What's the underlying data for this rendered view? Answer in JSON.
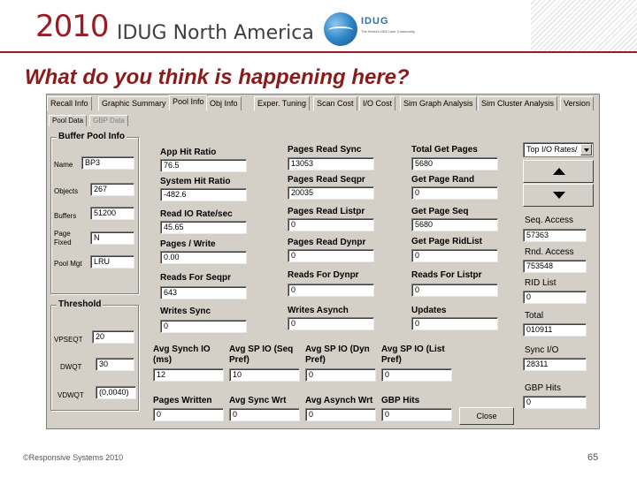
{
  "header": {
    "year": "2010",
    "conference": "IDUG North America",
    "logo_text": "IDUG",
    "logo_tagline": "The World's DB2 User Community"
  },
  "slide": {
    "title": "What do you think is happening here?",
    "copyright": "©Responsive Systems 2010",
    "page_number": "65"
  },
  "tabs": [
    "Recall Info",
    "Graphic Summary",
    "Pool Info",
    "Obj Info",
    "Exper. Tuning",
    "Scan Cost",
    "I/O Cost",
    "Sim Graph Analysis",
    "Sim Cluster Analysis",
    "Version"
  ],
  "active_tab": "Pool Info",
  "subtabs": [
    "Pool Data",
    "GBP Data"
  ],
  "buffer_pool": {
    "title": "Buffer Pool Info",
    "name_label": "Name",
    "name_value": "BP3",
    "objects_label": "Objects",
    "objects_value": "267",
    "buffers_label": "Buffers",
    "buffers_value": "51200",
    "pagefixed_label": "Page Fixed",
    "pagefixed_value": "N",
    "poolmgt_label": "Pool Mgt",
    "poolmgt_value": "LRU"
  },
  "threshold": {
    "title": "Threshold",
    "vpseqt_label": "VPSEQT",
    "vpseqt_value": "20",
    "dwqt_label": "DWQT",
    "dwqt_value": "30",
    "vdwqt_label": "VDWQT",
    "vdwqt_value": "(0,0040)"
  },
  "metrics": {
    "app_hit_ratio": {
      "label": "App Hit Ratio",
      "value": "76.5"
    },
    "system_hit_ratio": {
      "label": "System Hit Ratio",
      "value": "-482.6"
    },
    "read_io_rate": {
      "label": "Read IO Rate/sec",
      "value": "45.65"
    },
    "pages_write": {
      "label": "Pages / Write",
      "value": "0.00"
    },
    "reads_for_seqpr": {
      "label": "Reads For Seqpr",
      "value": "643"
    },
    "writes_sync": {
      "label": "Writes Sync",
      "value": "0"
    },
    "pages_read_sync": {
      "label": "Pages Read Sync",
      "value": "13053"
    },
    "pages_read_seqpr": {
      "label": "Pages Read Seqpr",
      "value": "20035"
    },
    "pages_read_listpr": {
      "label": "Pages Read Listpr",
      "value": "0"
    },
    "pages_read_dynpr": {
      "label": "Pages Read Dynpr",
      "value": "0"
    },
    "reads_for_dynpr": {
      "label": "Reads For Dynpr",
      "value": "0"
    },
    "writes_asynch": {
      "label": "Writes Asynch",
      "value": "0"
    },
    "total_get_pages": {
      "label": "Total Get Pages",
      "value": "5680"
    },
    "get_page_rand": {
      "label": "Get Page Rand",
      "value": "0"
    },
    "get_page_seq": {
      "label": "Get Page Seq",
      "value": "5680"
    },
    "get_page_ridlist": {
      "label": "Get Page RidList",
      "value": "0"
    },
    "reads_for_listpr": {
      "label": "Reads For Listpr",
      "value": "0"
    },
    "updates": {
      "label": "Updates",
      "value": "0"
    },
    "avg_synch_io": {
      "label": "Avg Synch IO (ms)",
      "value": "12"
    },
    "avg_sp_io_seq": {
      "label": "Avg SP IO (Seq Pref)",
      "value": "10"
    },
    "avg_sp_io_dyn": {
      "label": "Avg SP IO (Dyn Pref)",
      "value": "0"
    },
    "avg_sp_io_list": {
      "label": "Avg SP IO (List Pref)",
      "value": "0"
    },
    "pages_written": {
      "label": "Pages Written",
      "value": "0"
    },
    "avg_sync_wrt": {
      "label": "Avg Sync Wrt",
      "value": "0"
    },
    "avg_asynch_wrt": {
      "label": "Avg Asynch Wrt",
      "value": "0"
    },
    "gbp_hits_mid": {
      "label": "GBP Hits",
      "value": "0"
    }
  },
  "right_panel": {
    "dropdown_value": "Top I/O Rates/",
    "seq_access": {
      "label": "Seq. Access",
      "value": "57363"
    },
    "rnd_access": {
      "label": "Rnd. Access",
      "value": "753548"
    },
    "rid_list": {
      "label": "RID List",
      "value": "0"
    },
    "total": {
      "label": "Total",
      "value": "010911"
    },
    "sync_io": {
      "label": "Sync I/O",
      "value": "28311"
    },
    "gbp_hits": {
      "label": "GBP Hits",
      "value": "0"
    }
  },
  "buttons": {
    "close": "Close"
  }
}
